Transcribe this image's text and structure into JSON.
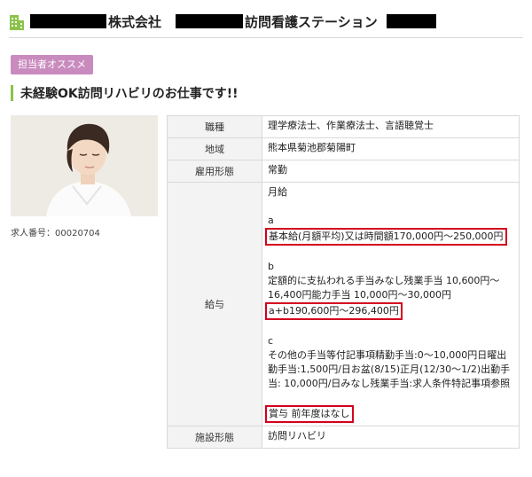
{
  "header": {
    "company_suffix": "株式会社",
    "station_name": "訪問看護ステーション"
  },
  "badge": "担当者オススメ",
  "catchcopy": "未経験OK訪問リハビリのお仕事です!!",
  "job_number": "求人番号：00020704",
  "colors": {
    "accent_green": "#8bc34a",
    "badge_pink": "#c98bbe",
    "highlight_red": "#d4001d"
  },
  "table": {
    "occupation": {
      "label": "職種",
      "value": "理学療法士、作業療法士、言語聴覚士"
    },
    "area": {
      "label": "地域",
      "value": "熊本県菊池郡菊陽町"
    },
    "employment": {
      "label": "雇用形態",
      "value": "常勤"
    },
    "salary": {
      "label": "給与",
      "type": "月給",
      "a_label": "a",
      "a_text": "基本給(月額平均)又は時間額170,000円〜250,000円",
      "b_label": "b",
      "b_text": "定額的に支払われる手当みなし残業手当 10,600円〜16,400円能力手当 10,000円〜30,000円",
      "ab_text": "a+b190,600円〜296,400円",
      "c_label": "c",
      "c_text": "その他の手当等付記事項精勤手当:0〜10,000円日曜出勤手当:1,500円/日お盆(8/15)正月(12/30〜1/2)出勤手当: 10,000円/日みなし残業手当:求人条件特記事項参照",
      "bonus_text": "賞与 前年度はなし"
    },
    "facility": {
      "label": "施設形態",
      "value": "訪問リハビリ"
    }
  }
}
